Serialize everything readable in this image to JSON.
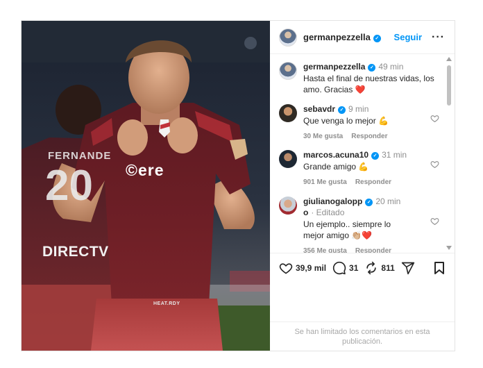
{
  "post": {
    "author": {
      "username": "germanpezzella",
      "verified": true,
      "avatar_icon": "profile-avatar"
    },
    "follow_label": "Seguir",
    "more_icon": "more-options-icon",
    "caption": {
      "username": "germanpezzella",
      "time": "49 min",
      "text": "Hasta el final de nuestras vidas, los amo. Gracias ❤️"
    },
    "photo": {
      "alt_icon": "post-photo",
      "jersey_text": "©ere",
      "background_jersey_text": "DIRECTV",
      "background_name": "FERNANDE",
      "background_number": "20",
      "brand_text": "HEAT.RDY"
    }
  },
  "comments": [
    {
      "username": "sebavdr",
      "verified": true,
      "time": "9 min",
      "edited": "",
      "text": "Que venga lo mejor 💪",
      "likes": "30 Me gusta",
      "reply": "Responder"
    },
    {
      "username": "marcos.acuna10",
      "verified": true,
      "time": "31 min",
      "edited": "",
      "text": "Grande amigo 💪",
      "likes": "901 Me gusta",
      "reply": "Responder"
    },
    {
      "username": "giulianogalopp",
      "username_overflow": "o",
      "verified": true,
      "time": "20 min",
      "edited": "Editado",
      "text": "Un ejemplo.. siempre lo mejor amigo 👏🏼❤️",
      "likes": "356 Me gusta",
      "reply": "Responder"
    }
  ],
  "actions": {
    "likes_count": "39,9 mil",
    "comments_count": "31",
    "reposts_count": "811",
    "icons": [
      "heart-icon",
      "comment-icon",
      "repost-icon",
      "share-icon",
      "bookmark-icon"
    ]
  },
  "footer": {
    "limited_comments": "Se han limitado los comentarios en esta publicación."
  },
  "colors": {
    "accent": "#0095f6",
    "text": "#262626",
    "muted": "#8e8e8e",
    "like_red": "#ff3040",
    "jersey": "#6e1d22"
  }
}
